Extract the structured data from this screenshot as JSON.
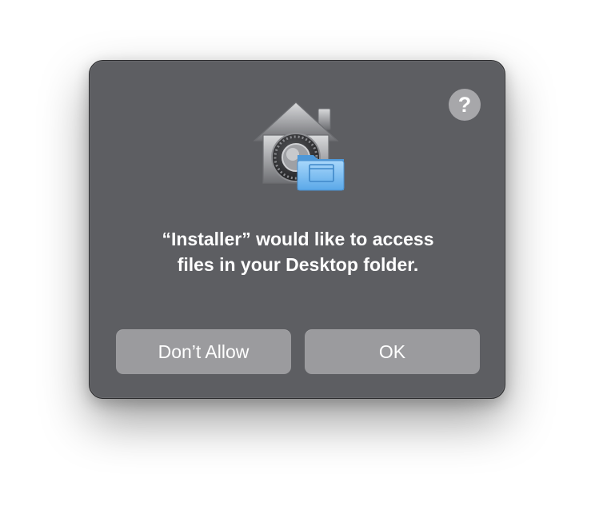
{
  "dialog": {
    "help_label": "?",
    "icon_name": "security-house-folder-icon",
    "message_line1": "“Installer” would like to access",
    "message_line2": "files in your Desktop folder.",
    "buttons": {
      "dont_allow_label": "Don’t Allow",
      "ok_label": "OK"
    }
  },
  "colors": {
    "dialog_background": "#5d5e62",
    "button_background": "#9b9b9e",
    "help_button_background": "#a7a7aa",
    "folder_blue": "#7cc0f4",
    "text": "#ffffff"
  }
}
